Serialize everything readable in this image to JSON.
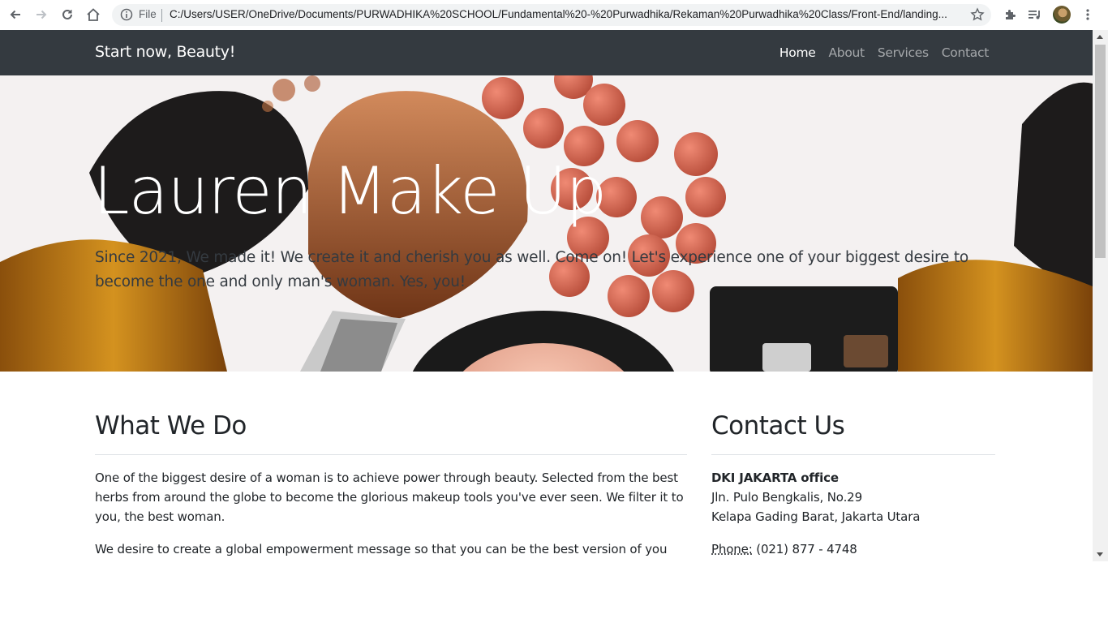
{
  "browser": {
    "omnibox_prefix": "File",
    "url": "C:/Users/USER/OneDrive/Documents/PURWADHIKA%20SCHOOL/Fundamental%20-%20Purwadhika/Rekaman%20Purwadhika%20Class/Front-End/landing..."
  },
  "navbar": {
    "brand": "Start now, Beauty!",
    "links": [
      "Home",
      "About",
      "Services",
      "Contact"
    ],
    "active": "Home"
  },
  "hero": {
    "title": "Lauren Make Up",
    "lead": "Since 2021, We made it! We create it and cherish you as well. Come on! Let's experience one of your biggest desire to become the one and only man's woman. Yes, you!"
  },
  "what_we_do": {
    "title": "What We Do",
    "paragraph1": "One of the biggest desire of a woman is to achieve power through beauty. Selected from the best herbs from around the globe to become the glorious makeup tools you've ever seen. We filter it to you, the best woman.",
    "paragraph2": "We desire to create a global empowerment message so that you can be the best version of you"
  },
  "contact": {
    "title": "Contact Us",
    "office": "DKI JAKARTA office",
    "address_line1": "Jln. Pulo Bengkalis, No.29",
    "address_line2": "Kelapa Gading Barat, Jakarta Utara",
    "phone_label": "Phone:",
    "phone": "(021) 877 - 4748"
  }
}
